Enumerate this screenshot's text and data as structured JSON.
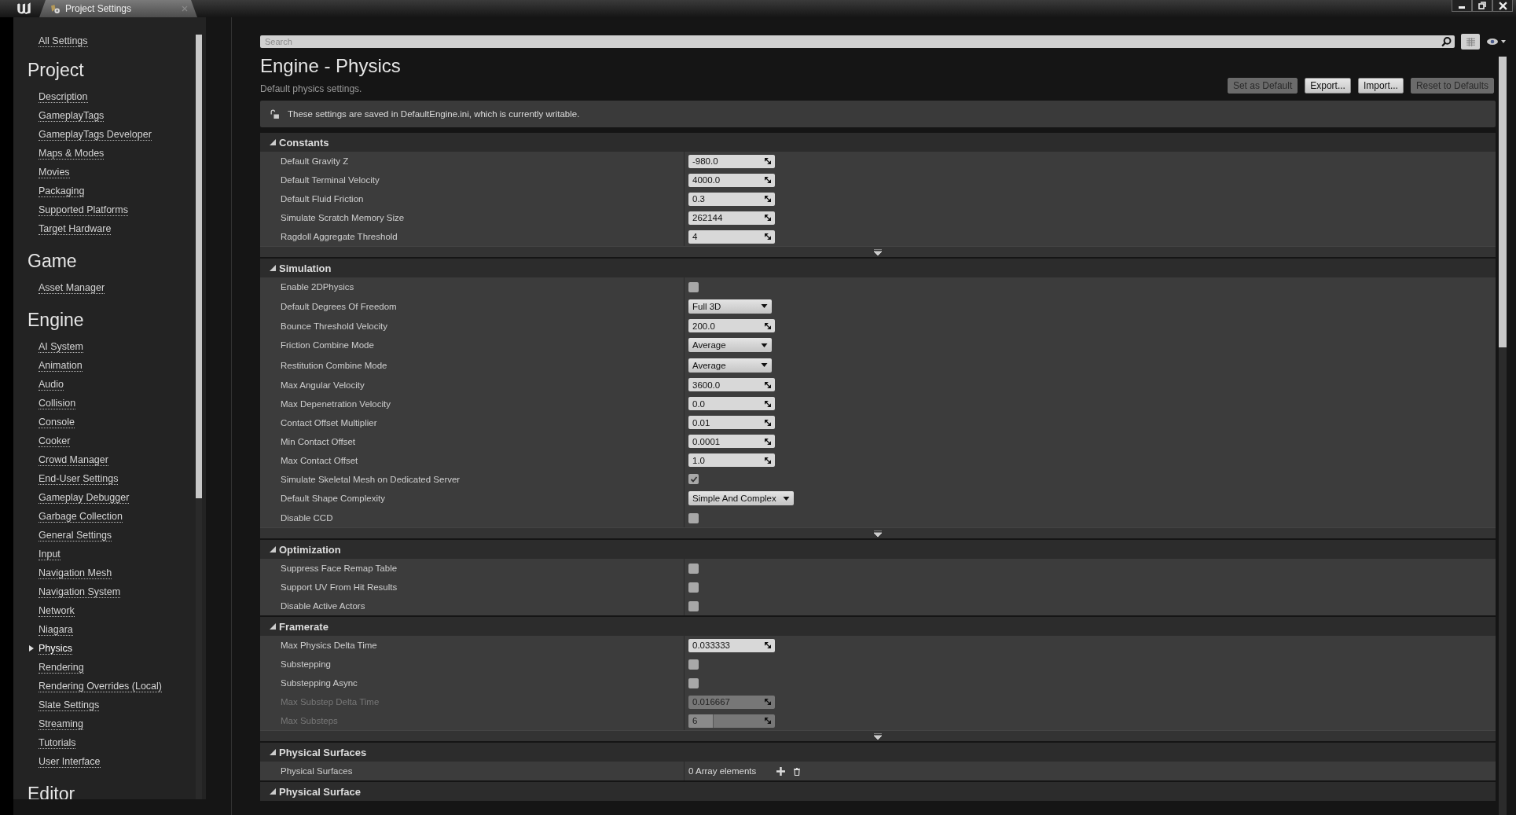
{
  "window": {
    "tab_title": "Project Settings"
  },
  "sidebar": {
    "top_link": {
      "label": "All Settings",
      "selected": false
    },
    "groups": [
      {
        "heading": "Project",
        "items": [
          {
            "label": "Description",
            "selected": false
          },
          {
            "label": "GameplayTags",
            "selected": false
          },
          {
            "label": "GameplayTags Developer",
            "selected": false
          },
          {
            "label": "Maps & Modes",
            "selected": false
          },
          {
            "label": "Movies",
            "selected": false
          },
          {
            "label": "Packaging",
            "selected": false
          },
          {
            "label": "Supported Platforms",
            "selected": false
          },
          {
            "label": "Target Hardware",
            "selected": false
          }
        ]
      },
      {
        "heading": "Game",
        "items": [
          {
            "label": "Asset Manager",
            "selected": false
          }
        ]
      },
      {
        "heading": "Engine",
        "items": [
          {
            "label": "AI System",
            "selected": false
          },
          {
            "label": "Animation",
            "selected": false
          },
          {
            "label": "Audio",
            "selected": false
          },
          {
            "label": "Collision",
            "selected": false
          },
          {
            "label": "Console",
            "selected": false
          },
          {
            "label": "Cooker",
            "selected": false
          },
          {
            "label": "Crowd Manager",
            "selected": false
          },
          {
            "label": "End-User Settings",
            "selected": false
          },
          {
            "label": "Gameplay Debugger",
            "selected": false
          },
          {
            "label": "Garbage Collection",
            "selected": false
          },
          {
            "label": "General Settings",
            "selected": false
          },
          {
            "label": "Input",
            "selected": false
          },
          {
            "label": "Navigation Mesh",
            "selected": false
          },
          {
            "label": "Navigation System",
            "selected": false
          },
          {
            "label": "Network",
            "selected": false
          },
          {
            "label": "Niagara",
            "selected": false
          },
          {
            "label": "Physics",
            "selected": true
          },
          {
            "label": "Rendering",
            "selected": false
          },
          {
            "label": "Rendering Overrides (Local)",
            "selected": false
          },
          {
            "label": "Slate Settings",
            "selected": false
          },
          {
            "label": "Streaming",
            "selected": false
          },
          {
            "label": "Tutorials",
            "selected": false
          },
          {
            "label": "User Interface",
            "selected": false
          }
        ]
      },
      {
        "heading": "Editor"
      }
    ]
  },
  "search": {
    "placeholder": "Search"
  },
  "page": {
    "title": "Engine - Physics",
    "subtitle": "Default physics settings.",
    "buttons": [
      {
        "label": "Set as Default",
        "disabled": true
      },
      {
        "label": "Export...",
        "disabled": false
      },
      {
        "label": "Import...",
        "disabled": false
      },
      {
        "label": "Reset to Defaults",
        "disabled": true
      }
    ],
    "notice": "These settings are saved in DefaultEngine.ini, which is currently writable."
  },
  "sections": [
    {
      "title": "Constants",
      "expanded": true,
      "advanced_toggle": true,
      "rows": [
        {
          "label": "Default Gravity Z",
          "kind": "number",
          "value": "-980.0",
          "disabled": false
        },
        {
          "label": "Default Terminal Velocity",
          "kind": "number",
          "value": "4000.0",
          "disabled": false
        },
        {
          "label": "Default Fluid Friction",
          "kind": "number",
          "value": "0.3",
          "disabled": false
        },
        {
          "label": "Simulate Scratch Memory Size",
          "kind": "number",
          "value": "262144",
          "disabled": false
        },
        {
          "label": "Ragdoll Aggregate Threshold",
          "kind": "number",
          "value": "4",
          "disabled": false
        }
      ]
    },
    {
      "title": "Simulation",
      "expanded": true,
      "advanced_toggle": true,
      "rows": [
        {
          "label": "Enable 2DPhysics",
          "kind": "checkbox",
          "checked": false,
          "disabled": false
        },
        {
          "label": "Default Degrees Of Freedom",
          "kind": "dropdown",
          "value": "Full 3D",
          "disabled": false
        },
        {
          "label": "Bounce Threshold Velocity",
          "kind": "number",
          "value": "200.0",
          "disabled": false
        },
        {
          "label": "Friction Combine Mode",
          "kind": "dropdown",
          "value": "Average",
          "disabled": false
        },
        {
          "label": "Restitution Combine Mode",
          "kind": "dropdown",
          "value": "Average",
          "disabled": false
        },
        {
          "label": "Max Angular Velocity",
          "kind": "number",
          "value": "3600.0",
          "disabled": false
        },
        {
          "label": "Max Depenetration Velocity",
          "kind": "number",
          "value": "0.0",
          "disabled": false
        },
        {
          "label": "Contact Offset Multiplier",
          "kind": "number",
          "value": "0.01",
          "disabled": false
        },
        {
          "label": "Min Contact Offset",
          "kind": "number",
          "value": "0.0001",
          "disabled": false
        },
        {
          "label": "Max Contact Offset",
          "kind": "number",
          "value": "1.0",
          "disabled": false
        },
        {
          "label": "Simulate Skeletal Mesh on Dedicated Server",
          "kind": "checkbox",
          "checked": true,
          "disabled": false
        },
        {
          "label": "Default Shape Complexity",
          "kind": "dropdown",
          "value": "Simple And Complex",
          "disabled": false
        },
        {
          "label": "Disable CCD",
          "kind": "checkbox",
          "checked": false,
          "disabled": false
        }
      ]
    },
    {
      "title": "Optimization",
      "expanded": true,
      "advanced_toggle": false,
      "rows": [
        {
          "label": "Suppress Face Remap Table",
          "kind": "checkbox",
          "checked": false,
          "disabled": false
        },
        {
          "label": "Support UV From Hit Results",
          "kind": "checkbox",
          "checked": false,
          "disabled": false
        },
        {
          "label": "Disable Active Actors",
          "kind": "checkbox",
          "checked": false,
          "disabled": false
        }
      ]
    },
    {
      "title": "Framerate",
      "expanded": true,
      "advanced_toggle": true,
      "rows": [
        {
          "label": "Max Physics Delta Time",
          "kind": "number",
          "value": "0.033333",
          "disabled": false
        },
        {
          "label": "Substepping",
          "kind": "checkbox",
          "checked": false,
          "disabled": false
        },
        {
          "label": "Substepping Async",
          "kind": "checkbox",
          "checked": false,
          "disabled": false
        },
        {
          "label": "Max Substep Delta Time",
          "kind": "number",
          "value": "0.016667",
          "disabled": true
        },
        {
          "label": "Max Substeps",
          "kind": "number",
          "value": "6",
          "disabled": true,
          "level": 0.28
        }
      ]
    },
    {
      "title": "Physical Surfaces",
      "expanded": true,
      "advanced_toggle": false,
      "rows": [
        {
          "label": "Physical Surfaces",
          "kind": "array",
          "value": "0 Array elements",
          "disabled": false
        }
      ]
    },
    {
      "title": "Physical Surface",
      "expanded": true,
      "advanced_toggle": false
    }
  ]
}
